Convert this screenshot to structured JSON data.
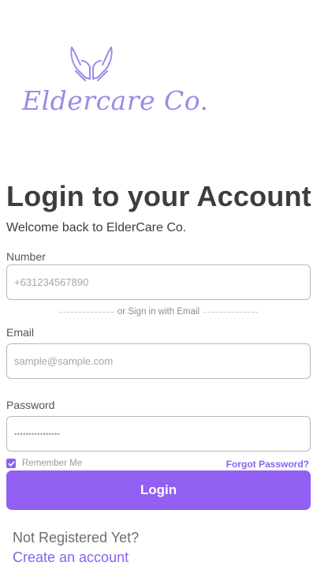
{
  "brand": {
    "name": "Eldercare Co.",
    "logo_icon": "caring-hands-icon",
    "accent_color": "#9b8ae8"
  },
  "header": {
    "title": "Login to your Account",
    "subtitle": "Welcome back to ElderCare Co."
  },
  "form": {
    "number_label": "Number",
    "number_placeholder": "+631234567890",
    "divider_text": "or Sign in with Email",
    "email_label": "Email",
    "email_placeholder": "sample@sample.com",
    "password_label": "Password",
    "password_value": "••••••••••••••••",
    "remember_me_label": "Remember Me",
    "remember_me_checked": true,
    "forgot_password_label": "Forgot Password?",
    "login_button_label": "Login"
  },
  "footer": {
    "not_registered_text": "Not Registered Yet?",
    "create_account_label": "Create an account"
  },
  "colors": {
    "primary": "#9160f2",
    "text_dark": "#3d3d3d",
    "link": "#8a62f0"
  }
}
